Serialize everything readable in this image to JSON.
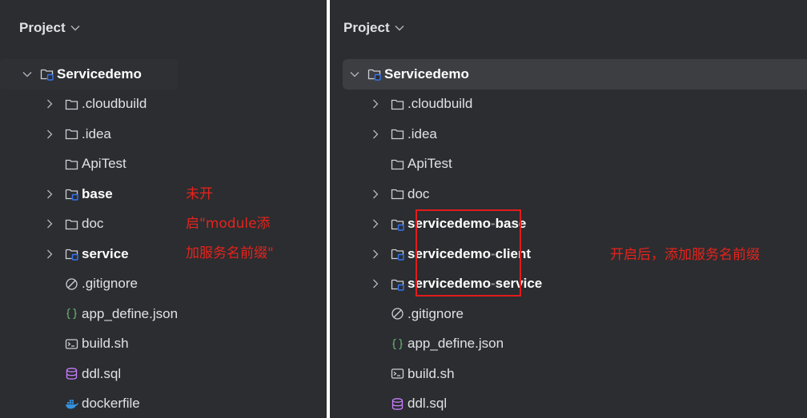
{
  "colors": {
    "panel_bg": "#2b2d30",
    "selection_bg": "#3c3e42",
    "text": "#dfe1e5",
    "annotation_red": "#e8221b",
    "module_accent": "#3574f0"
  },
  "left_panel": {
    "title": "Project",
    "root": {
      "label": "Servicedemo",
      "icon": "module-folder-icon",
      "expanded": true
    },
    "items": [
      {
        "label": ".cloudbuild",
        "icon": "folder-icon",
        "has_arrow": true,
        "bold": false
      },
      {
        "label": ".idea",
        "icon": "folder-icon",
        "has_arrow": true,
        "bold": false
      },
      {
        "label": "ApiTest",
        "icon": "folder-icon",
        "has_arrow": false,
        "bold": false
      },
      {
        "label": "base",
        "icon": "module-folder-icon",
        "has_arrow": true,
        "bold": true
      },
      {
        "label": "doc",
        "icon": "folder-icon",
        "has_arrow": true,
        "bold": false
      },
      {
        "label": "service",
        "icon": "module-folder-icon",
        "has_arrow": true,
        "bold": true
      },
      {
        "label": ".gitignore",
        "icon": "ignore-file-icon",
        "has_arrow": false,
        "bold": false
      },
      {
        "label": "app_define.json",
        "icon": "json-file-icon",
        "has_arrow": false,
        "bold": false
      },
      {
        "label": "build.sh",
        "icon": "shell-script-icon",
        "has_arrow": false,
        "bold": false
      },
      {
        "label": "ddl.sql",
        "icon": "sql-file-icon",
        "has_arrow": false,
        "bold": false
      },
      {
        "label": "dockerfile",
        "icon": "docker-icon",
        "has_arrow": false,
        "bold": false
      }
    ],
    "annotation_lines": [
      "未开",
      "启\"module添",
      "加服务名前缀\""
    ]
  },
  "right_panel": {
    "title": "Project",
    "root": {
      "label": "Servicedemo",
      "icon": "module-folder-icon",
      "expanded": true
    },
    "items": [
      {
        "label": ".cloudbuild",
        "icon": "folder-icon",
        "has_arrow": true,
        "bold": false
      },
      {
        "label": ".idea",
        "icon": "folder-icon",
        "has_arrow": true,
        "bold": false
      },
      {
        "label": "ApiTest",
        "icon": "folder-icon",
        "has_arrow": false,
        "bold": false
      },
      {
        "label": "doc",
        "icon": "folder-icon",
        "has_arrow": true,
        "bold": false
      },
      {
        "label": "servicedemo-base",
        "prefix": "servicedemo",
        "suffix": "base",
        "icon": "module-folder-icon",
        "has_arrow": true,
        "bold": true
      },
      {
        "label": "servicedemo-client",
        "prefix": "servicedemo",
        "suffix": "client",
        "icon": "module-folder-icon",
        "has_arrow": true,
        "bold": true
      },
      {
        "label": "servicedemo-service",
        "prefix": "servicedemo",
        "suffix": "service",
        "icon": "module-folder-icon",
        "has_arrow": true,
        "bold": true
      },
      {
        "label": ".gitignore",
        "icon": "ignore-file-icon",
        "has_arrow": false,
        "bold": false
      },
      {
        "label": "app_define.json",
        "icon": "json-file-icon",
        "has_arrow": false,
        "bold": false
      },
      {
        "label": "build.sh",
        "icon": "shell-script-icon",
        "has_arrow": false,
        "bold": false
      },
      {
        "label": "ddl.sql",
        "icon": "sql-file-icon",
        "has_arrow": false,
        "bold": false
      }
    ],
    "annotation": "开启后，添加服务名前缀"
  }
}
